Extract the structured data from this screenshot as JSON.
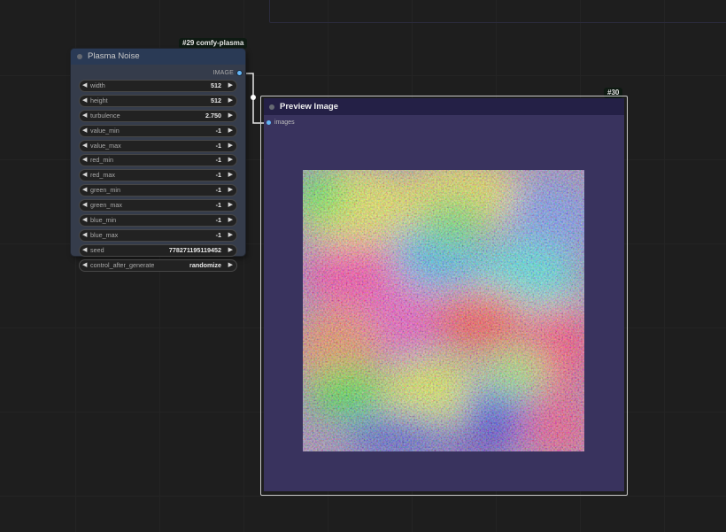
{
  "canvas": {
    "background": "#1e1e1e"
  },
  "nodes": {
    "plasma": {
      "badge": "#29 comfy-plasma",
      "title": "Plasma Noise",
      "output_label": "IMAGE",
      "widgets": [
        {
          "name": "width",
          "value": "512"
        },
        {
          "name": "height",
          "value": "512"
        },
        {
          "name": "turbulence",
          "value": "2.750"
        },
        {
          "name": "value_min",
          "value": "-1"
        },
        {
          "name": "value_max",
          "value": "-1"
        },
        {
          "name": "red_min",
          "value": "-1"
        },
        {
          "name": "red_max",
          "value": "-1"
        },
        {
          "name": "green_min",
          "value": "-1"
        },
        {
          "name": "green_max",
          "value": "-1"
        },
        {
          "name": "blue_min",
          "value": "-1"
        },
        {
          "name": "blue_max",
          "value": "-1"
        },
        {
          "name": "seed",
          "value": "778271195119452"
        },
        {
          "name": "control_after_generate",
          "value": "randomize"
        }
      ]
    },
    "preview": {
      "badge": "#30",
      "title": "Preview Image",
      "input_label": "images"
    }
  },
  "colors": {
    "slot_image": "#64b5f6",
    "preview_body": "#39335e",
    "preview_title": "#242046",
    "plasma_body": "#353c4b",
    "plasma_title": "#2a3a55",
    "link": "#e6e6e6"
  },
  "icons": {
    "decrement": "left-triangle",
    "increment": "right-triangle",
    "status_dot": "circle"
  }
}
